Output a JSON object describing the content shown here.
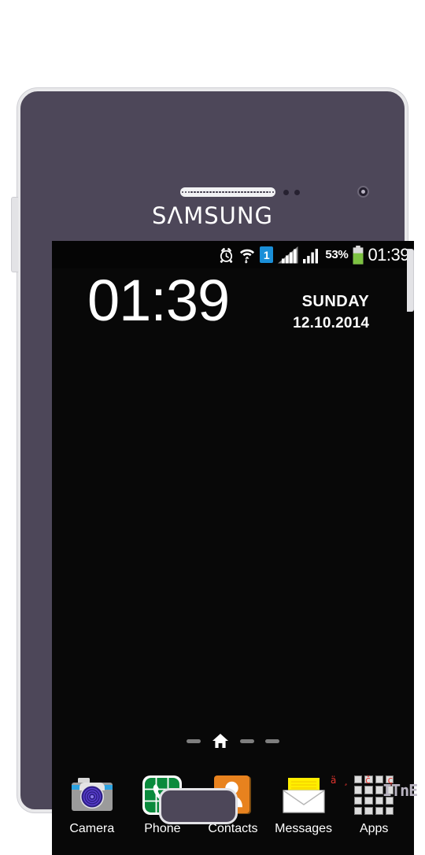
{
  "device": {
    "brand_logo": "SΛMSUNG",
    "bezel_color": "#4d4759",
    "frame_color": "#e8e8ea",
    "screen_color": "#080808"
  },
  "hardware": {
    "earpiece": "earpiece-speaker",
    "proximity_sensor": "proximity-sensor",
    "light_sensor": "light-sensor",
    "front_camera": "front-camera",
    "volume_button": "volume-rocker",
    "power_button": "power-button",
    "home_button": "home-button"
  },
  "status_bar": {
    "alarm_icon": "alarm-clock-icon",
    "wifi_icon": "wifi-icon",
    "sim_badge": "1",
    "signal_1_icon": "signal-bars-inactive-icon",
    "signal_2_icon": "signal-bars-active-icon",
    "battery_percent": "53%",
    "battery_icon": "battery-icon",
    "battery_color": "#7dc242",
    "clock": "01:39"
  },
  "clock_widget": {
    "time": "01:39",
    "weekday": "SUNDAY",
    "date": "12.10.2014"
  },
  "page_indicator": {
    "home_icon": "home-icon",
    "pages": [
      "dash",
      "home",
      "dash",
      "dash"
    ],
    "current_index": 1
  },
  "dock": {
    "items": [
      {
        "label": "Camera",
        "icon": "camera-icon",
        "color": "#9b9b9b"
      },
      {
        "label": "Phone",
        "icon": "phone-icon",
        "color": "#0a8a3c"
      },
      {
        "label": "Contacts",
        "icon": "contacts-icon",
        "color": "#e8821e"
      },
      {
        "label": "Messages",
        "icon": "messages-icon",
        "color": "#ffeb00"
      },
      {
        "label": "Apps",
        "icon": "apps-grid-icon",
        "color": "#dcdcdc"
      }
    ]
  },
  "watermark": {
    "text": "ä¸ č ç",
    "logo": "ITnE"
  }
}
